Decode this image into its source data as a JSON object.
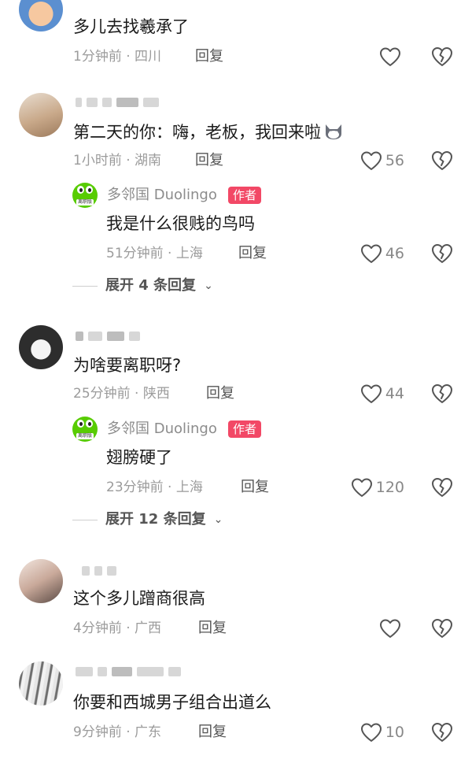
{
  "comments": [
    {
      "text": "多儿去找羲承了",
      "meta": "1分钟前 · 四川",
      "reply_label": "回复",
      "likes": ""
    },
    {
      "text": "第二天的你：嗨，老板，我回来啦",
      "meta": "1小时前 · 湖南",
      "reply_label": "回复",
      "likes": "56",
      "reply": {
        "author": "多邻国 Duolingo",
        "author_tag": "作者",
        "avatar_badge": "离职版",
        "text": "我是什么很贱的鸟吗",
        "meta": "51分钟前 · 上海",
        "reply_label": "回复",
        "likes": "46"
      },
      "expand_label": "展开 4 条回复"
    },
    {
      "text": "为啥要离职呀?",
      "meta": "25分钟前 · 陕西",
      "reply_label": "回复",
      "likes": "44",
      "reply": {
        "author": "多邻国 Duolingo",
        "author_tag": "作者",
        "avatar_badge": "离职版",
        "text": "翅膀硬了",
        "meta": "23分钟前 · 上海",
        "reply_label": "回复",
        "likes": "120"
      },
      "expand_label": "展开 12 条回复"
    },
    {
      "text": "这个多儿蹭商很高",
      "meta": "4分钟前 · 广西",
      "reply_label": "回复",
      "likes": ""
    },
    {
      "text": "你要和西城男子组合出道么",
      "meta": "9分钟前 · 广东",
      "reply_label": "回复",
      "likes": "10"
    }
  ],
  "icons": {
    "like": "heart-outline-icon",
    "dislike": "broken-heart-icon",
    "expand": "chevron-down-icon"
  },
  "colors": {
    "author_tag_bg": "#f24866",
    "duolingo_green": "#58cc02",
    "meta_gray": "#9b9b9b"
  }
}
